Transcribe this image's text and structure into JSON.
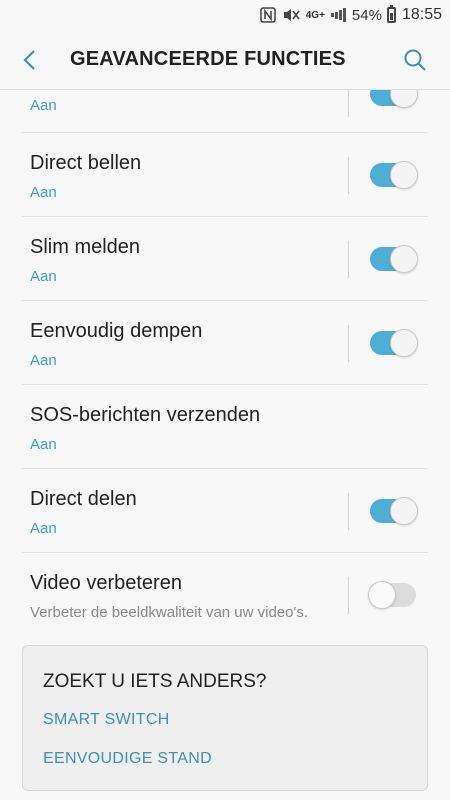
{
  "status_bar": {
    "network": "4G+",
    "battery": "54%",
    "time": "18:55"
  },
  "app_bar": {
    "title": "GEAVANCEERDE FUNCTIES"
  },
  "settings": [
    {
      "title": "",
      "subtitle": "Aan",
      "toggle": true
    },
    {
      "title": "Direct bellen",
      "subtitle": "Aan",
      "toggle": true
    },
    {
      "title": "Slim melden",
      "subtitle": "Aan",
      "toggle": true
    },
    {
      "title": "Eenvoudig dempen",
      "subtitle": "Aan",
      "toggle": true
    },
    {
      "title": "SOS-berichten verzenden",
      "subtitle": "Aan",
      "toggle": null
    },
    {
      "title": "Direct delen",
      "subtitle": "Aan",
      "toggle": true
    },
    {
      "title": "Video verbeteren",
      "subtitle": "Verbeter de beeldkwaliteit van uw video's.",
      "toggle": false
    }
  ],
  "card": {
    "title": "ZOEKT U IETS ANDERS?",
    "links": [
      "SMART SWITCH",
      "EENVOUDIGE STAND"
    ]
  }
}
